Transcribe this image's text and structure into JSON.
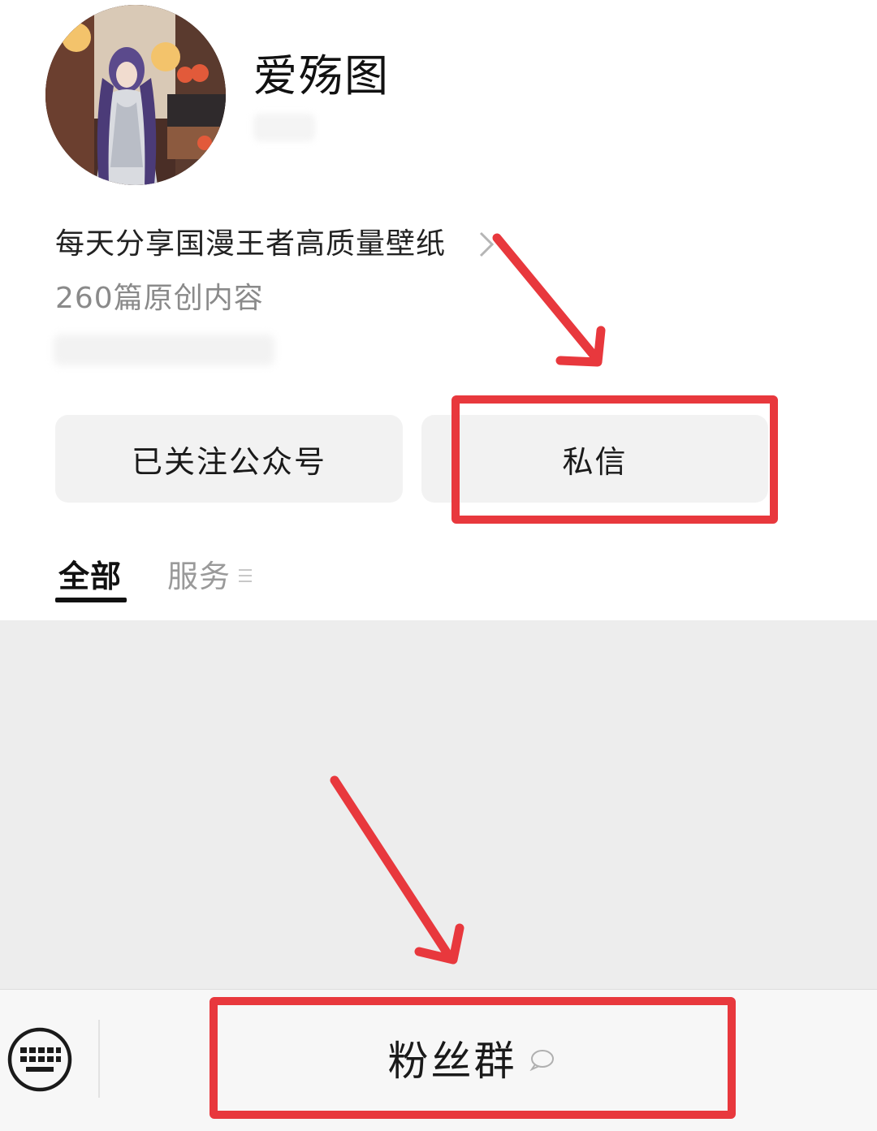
{
  "profile": {
    "name": "爱殇图",
    "bio": "每天分享国漫王者高质量壁纸",
    "article_count": "260篇原创内容"
  },
  "actions": {
    "follow_label": "已关注公众号",
    "message_label": "私信"
  },
  "tabs": [
    {
      "label": "全部",
      "active": true
    },
    {
      "label": "服务",
      "active": false
    }
  ],
  "bottom_bar": {
    "menu_label": "粉丝群",
    "keyboard_icon": "keyboard-icon",
    "menu_icon": "chat-bubble-icon"
  },
  "colors": {
    "annotation": "#e8383d",
    "button_bg": "#f2f2f2",
    "content_bg": "#ededed"
  }
}
